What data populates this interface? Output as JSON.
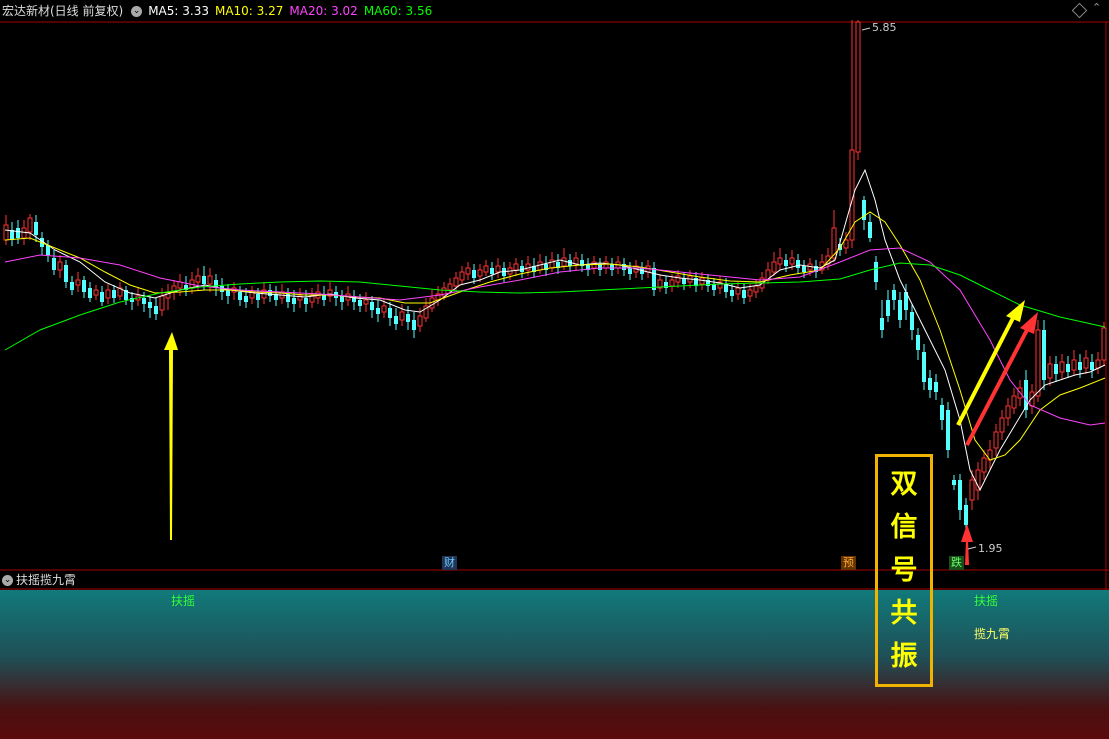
{
  "header": {
    "stock_name": "宏达新材(日线 前复权)",
    "ma5": "MA5: 3.33",
    "ma10": "MA10: 3.27",
    "ma20": "MA20: 3.02",
    "ma60": "MA60: 3.56",
    "colors": {
      "ma5": "#ffffff",
      "ma10": "#ffff00",
      "ma20": "#ff44ff",
      "ma60": "#00ff00"
    }
  },
  "price_labels": {
    "high": "5.85",
    "low": "1.95"
  },
  "event_markers": {
    "cai": "财",
    "yu": "预",
    "die": "跌"
  },
  "subchart": {
    "title": "扶摇揽九霄",
    "signal_fuyao": "扶摇",
    "signal_lanjiuxiao": "揽九霄"
  },
  "annotation": {
    "chars": [
      "双",
      "信",
      "号",
      "共",
      "振"
    ]
  },
  "colors": {
    "up": "#ff3333",
    "down": "#54ffff",
    "frame": "#aa0000",
    "accent": "#f0b400"
  }
}
